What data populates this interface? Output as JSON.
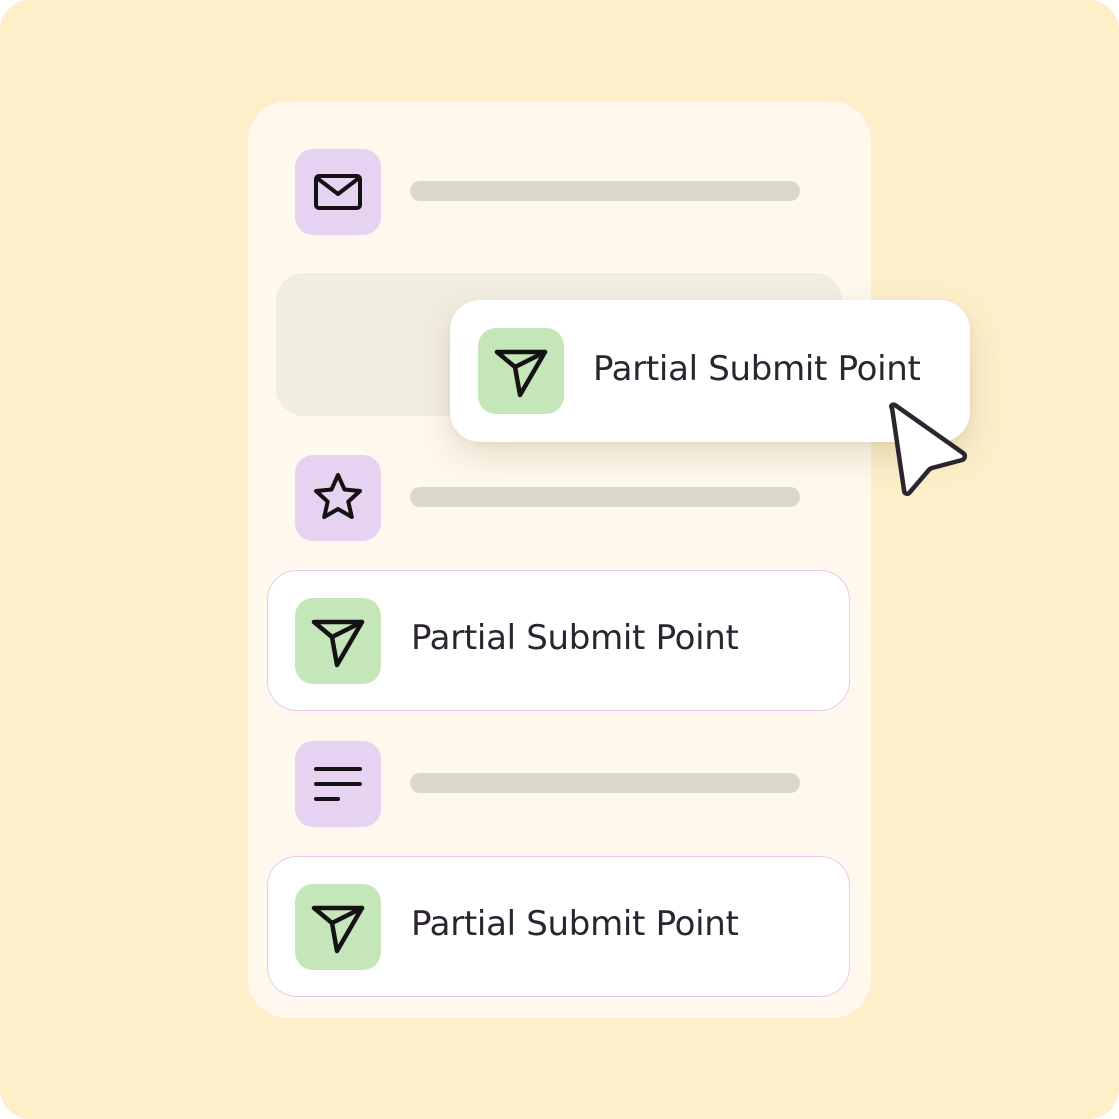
{
  "colors": {
    "background": "#FCEFC9",
    "panel": "#FEF9EC",
    "purple_tile": "#E6D3F1",
    "green_tile": "#C5E6B8",
    "placeholder": "#DBD7CB",
    "card_border": "#EBC9EE",
    "text": "#2C2530"
  },
  "list": {
    "rows": [
      {
        "type": "placeholder",
        "icon": "envelope-icon"
      },
      {
        "type": "drop-slot"
      },
      {
        "type": "placeholder",
        "icon": "star-icon"
      },
      {
        "type": "item",
        "icon": "send-icon",
        "label": "Partial Submit Point"
      },
      {
        "type": "placeholder",
        "icon": "text-lines-icon"
      },
      {
        "type": "item",
        "icon": "send-icon",
        "label": "Partial Submit Point"
      }
    ]
  },
  "dragging_card": {
    "icon": "send-icon",
    "label": "Partial Submit Point"
  },
  "cursor": {
    "icon": "pointer-cursor-icon"
  }
}
